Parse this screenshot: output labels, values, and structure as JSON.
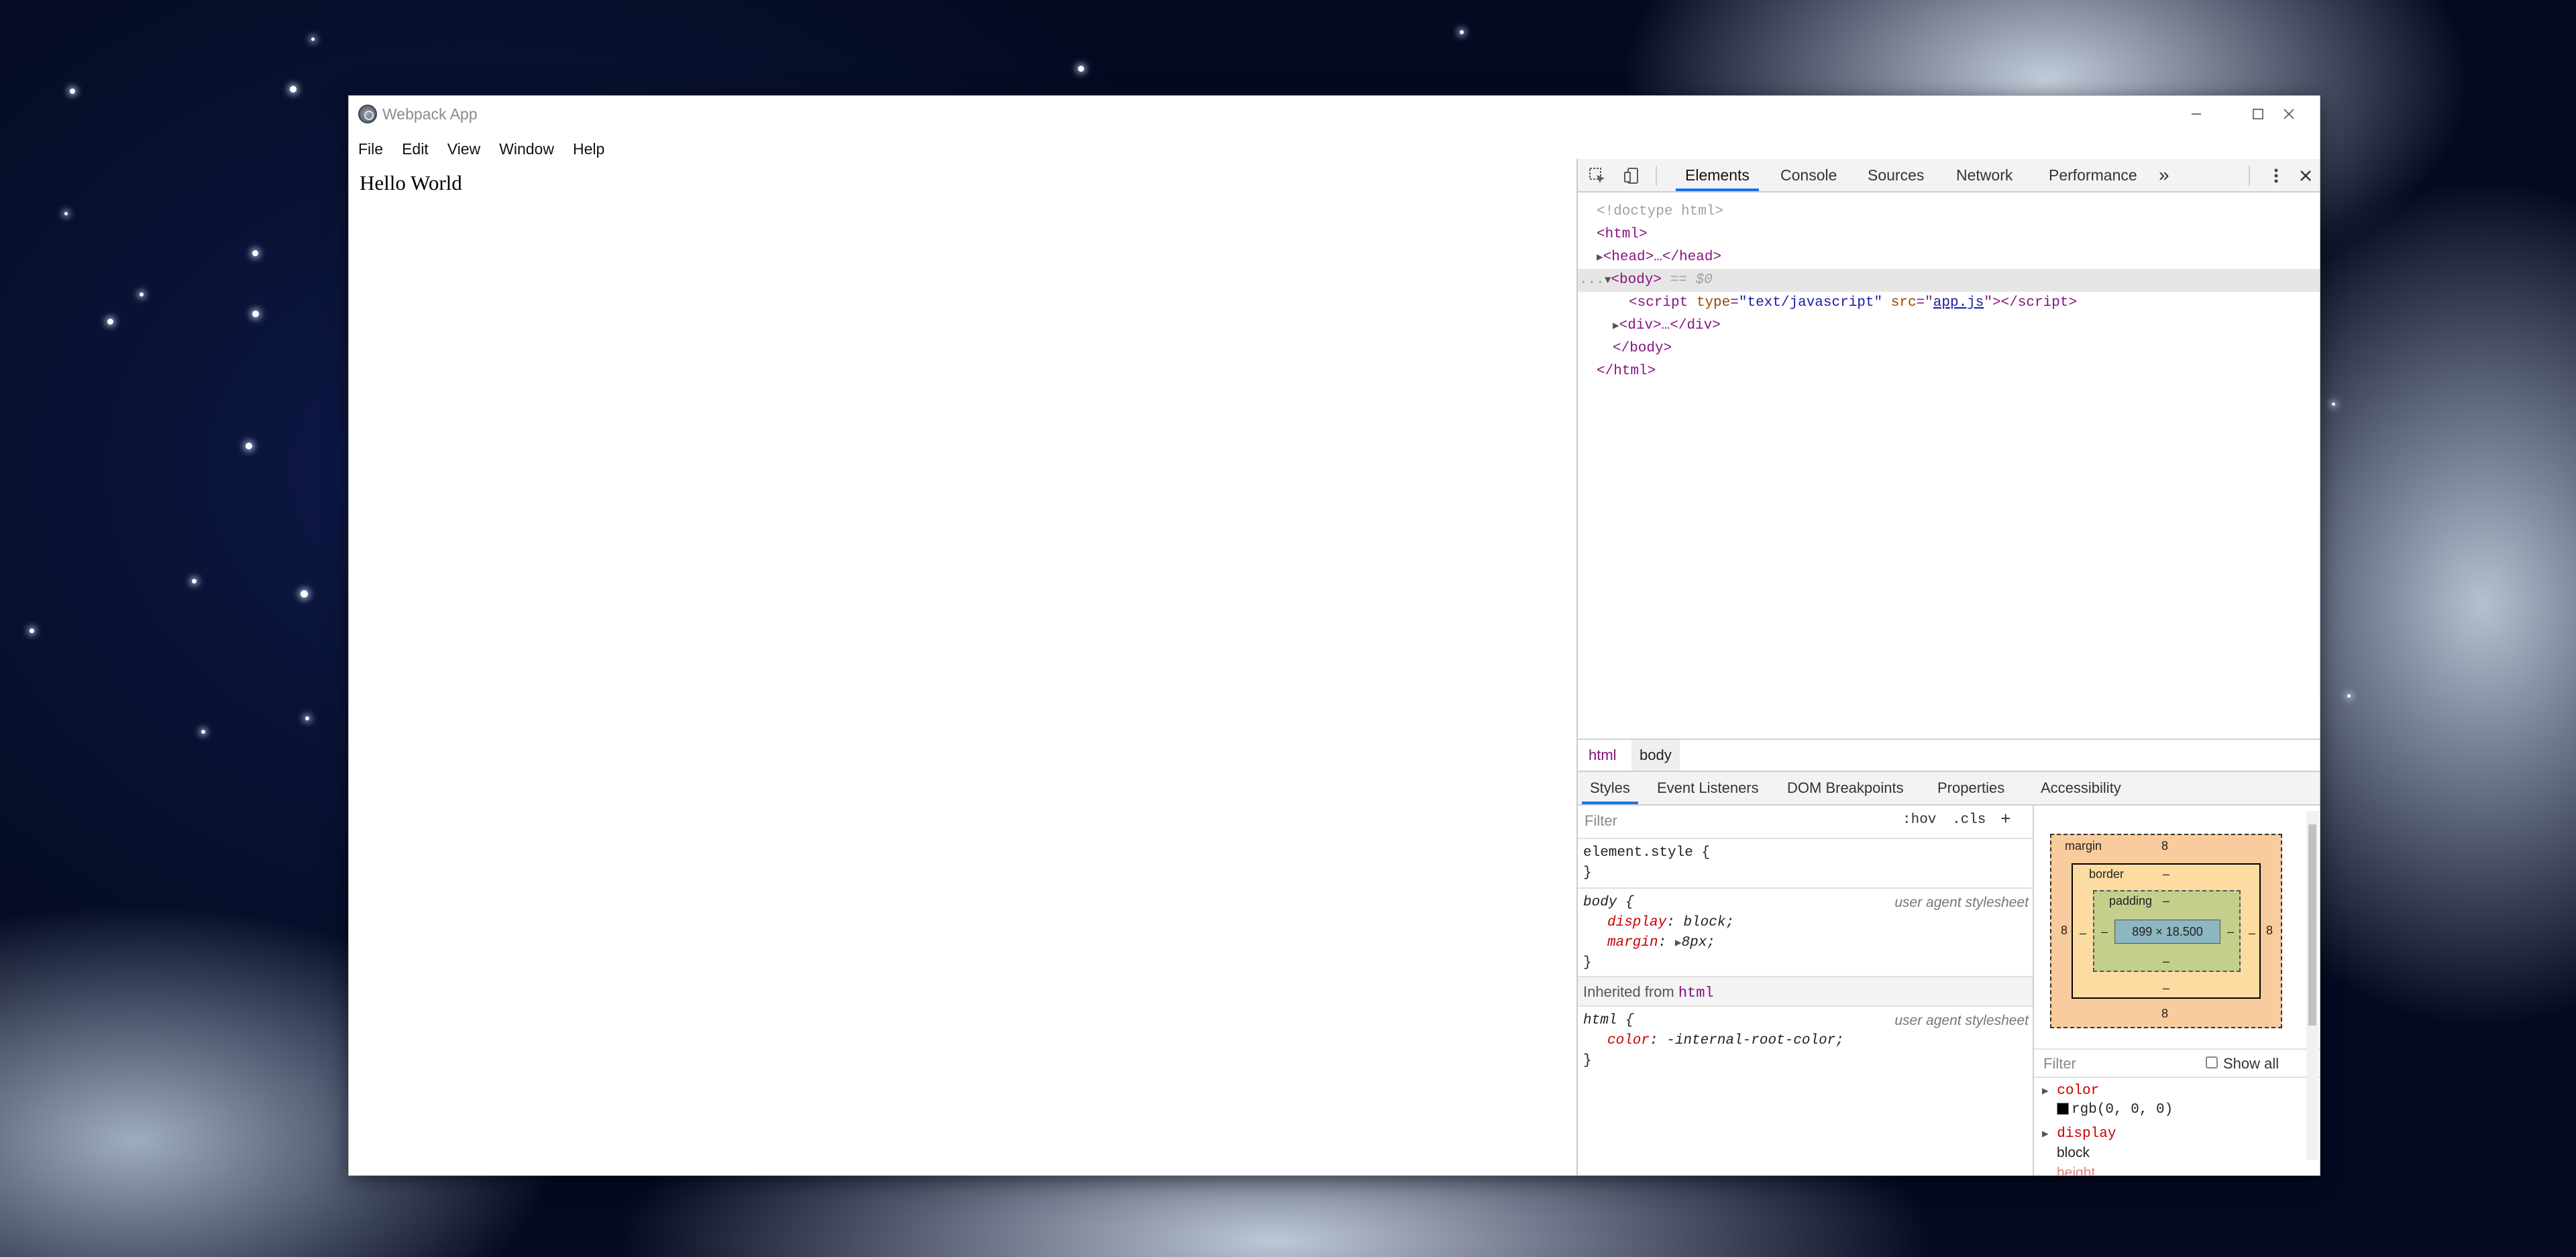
{
  "window": {
    "title": "Webpack App",
    "controls": {
      "minimize": "minimize",
      "maximize": "maximize",
      "close": "close"
    }
  },
  "menu": [
    "File",
    "Edit",
    "View",
    "Window",
    "Help"
  ],
  "content": {
    "text": "Hello World"
  },
  "devtools": {
    "tabs": [
      "Elements",
      "Console",
      "Sources",
      "Network",
      "Performance"
    ],
    "more_tabs": "»",
    "active_tab": "Elements",
    "dom": {
      "doctype": "<!doctype html>",
      "html_open": "<html>",
      "head": "<head>…</head>",
      "body_open": "<body>",
      "body_marker": "== $0",
      "script_tag": "script",
      "script_type_attr": "type",
      "script_type_val": "\"text/javascript\"",
      "script_src_attr": "src",
      "script_src_val": "app.js",
      "div": "<div>…</div>",
      "body_close": "</body>",
      "html_close": "</html>",
      "ellipsis": "..."
    },
    "breadcrumbs": [
      "html",
      "body"
    ],
    "subtabs": [
      "Styles",
      "Event Listeners",
      "DOM Breakpoints",
      "Properties",
      "Accessibility"
    ],
    "styles": {
      "filter_placeholder": "Filter",
      "hov": ":hov",
      "cls": ".cls",
      "add": "+",
      "element_style": "element.style {",
      "close_brace": "}",
      "body_selector": "body {",
      "ua_label": "user agent stylesheet",
      "display_prop": "display",
      "display_val": "block;",
      "margin_prop": "margin",
      "margin_val": "8px;",
      "inherited_label": "Inherited from",
      "inherited_tag": "html",
      "html_selector": "html {",
      "color_prop": "color",
      "color_val": "-internal-root-color;"
    },
    "box_model": {
      "margin_label": "margin",
      "border_label": "border",
      "padding_label": "padding",
      "margin_top": "8",
      "margin_bottom": "8",
      "margin_left": "8",
      "margin_right": "8",
      "dash": "–",
      "content": "899 × 18.500"
    },
    "computed": {
      "filter_placeholder": "Filter",
      "show_all": "Show all",
      "color_prop": "color",
      "color_val": "rgb(0, 0, 0)",
      "display_prop": "display",
      "display_val": "block",
      "height_prop": "height"
    }
  },
  "colors": {
    "accent": "#1a73e8",
    "tag": "#881280",
    "attr": "#994500"
  }
}
